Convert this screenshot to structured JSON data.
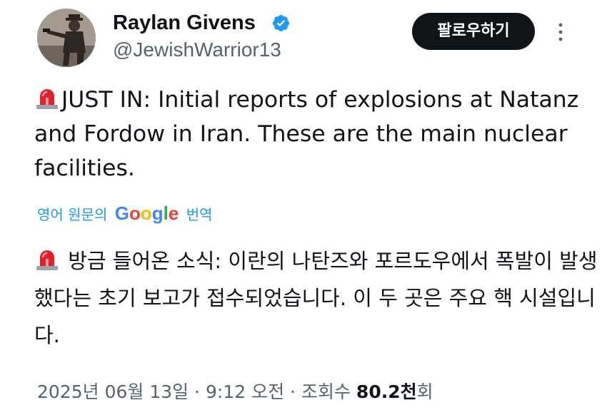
{
  "author": {
    "name": "Raylan Givens",
    "handle": "@JewishWarrior13",
    "verified": true,
    "verified_color": "#1d9bf0"
  },
  "actions": {
    "follow_label": "팔로우하기",
    "more_icon": "more-vertical-icon"
  },
  "tweet": {
    "emoji": "siren-icon",
    "text": "JUST IN: Initial reports of explosions at Natanz and Fordow in Iran. These are the main nuclear facilities."
  },
  "translation": {
    "prefix": "영어 원문의",
    "google": [
      "G",
      "o",
      "o",
      "g",
      "l",
      "e"
    ],
    "google_colors": [
      "#4285f4",
      "#ea4335",
      "#fbbc05",
      "#4285f4",
      "#34a853",
      "#ea4335"
    ],
    "suffix": "번역",
    "text": "방금 들어온 소식: 이란의 나탄즈와 포르도우에서 폭발이 발생했다는 초기 보고가 접수되었습니다. 이 두 곳은 주요 핵 시설입니다."
  },
  "meta": {
    "date": "2025년 06월 13일",
    "separator": "·",
    "time": "9:12 오전",
    "views_label": "조회수",
    "views_number": "80.2천",
    "views_suffix": "회"
  },
  "colors": {
    "text": "#0f1419",
    "secondary": "#536471",
    "link": "#1d9bf0",
    "siren_red": "#e0202a"
  }
}
